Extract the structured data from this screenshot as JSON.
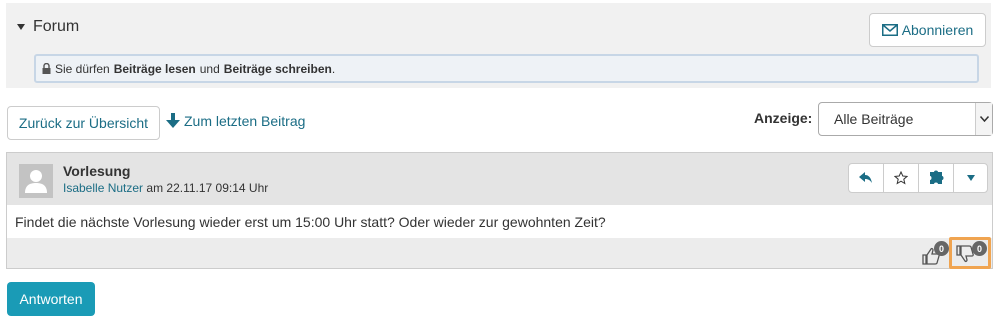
{
  "forum": {
    "title": "Forum",
    "subscribe_label": "Abonnieren",
    "permission": {
      "prefix": "Sie dürfen",
      "read": "Beiträge lesen",
      "and": "und",
      "write": "Beiträge schreiben",
      "suffix": "."
    }
  },
  "toolbar": {
    "back_label": "Zurück zur Übersicht",
    "last_post_label": "Zum letzten Beitrag",
    "display_label": "Anzeige:",
    "display_value": "Alle Beiträge"
  },
  "post": {
    "title": "Vorlesung",
    "author": "Isabelle Nutzer",
    "date_text": "am 22.11.17 09:14 Uhr",
    "body": "Findet die nächste Vorlesung wieder erst um 15:00 Uhr statt? Oder wieder zur gewohnten Zeit?",
    "likes": "0",
    "dislikes": "0",
    "actions": [
      "reply-icon",
      "star-icon",
      "puzzle-icon",
      "caret-down-icon"
    ]
  },
  "reply_label": "Antworten",
  "colors": {
    "link": "#1b6d85",
    "primary_button": "#1a9bb6",
    "highlight": "#f0a450"
  }
}
